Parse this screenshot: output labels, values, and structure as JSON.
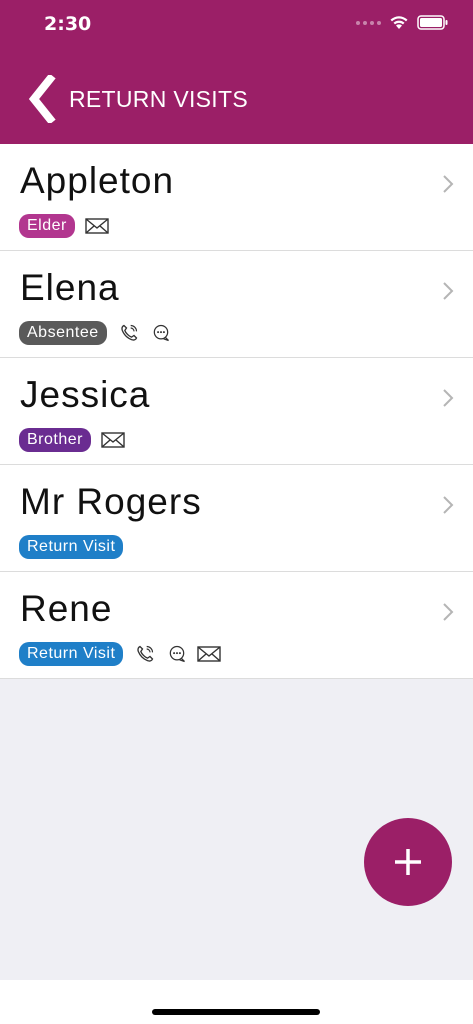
{
  "status_bar": {
    "time": "2:30"
  },
  "nav": {
    "title": "RETURN VISITS"
  },
  "colors": {
    "brand": "#9b1f67",
    "elder": "#b2368f",
    "absentee": "#5a5a5a",
    "brother": "#6a2c91",
    "return_visit": "#1f7fc8"
  },
  "items": [
    {
      "name": "Appleton",
      "badge": "Elder",
      "icons": [
        "envelope-icon"
      ]
    },
    {
      "name": "Elena",
      "badge": "Absentee",
      "icons": [
        "phone-icon",
        "chat-icon"
      ]
    },
    {
      "name": "Jessica",
      "badge": "Brother",
      "icons": [
        "envelope-icon"
      ]
    },
    {
      "name": "Mr Rogers",
      "badge": "Return Visit",
      "icons": []
    },
    {
      "name": "Rene",
      "badge": "Return Visit",
      "icons": [
        "phone-icon",
        "chat-icon",
        "envelope-icon"
      ]
    }
  ],
  "fab": {
    "icon": "plus-icon"
  }
}
